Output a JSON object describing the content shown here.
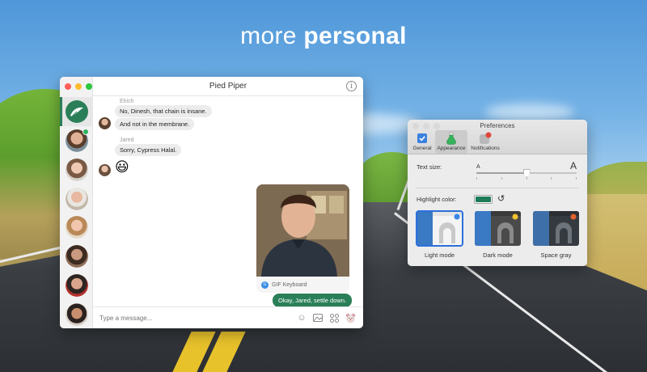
{
  "hero": {
    "light": "more ",
    "bold": "personal"
  },
  "chat": {
    "title": "Pied Piper",
    "messages": [
      {
        "sender": "Elrich",
        "lines": [
          "No, Dinesh, that chain is insane.",
          "And not in the membrane."
        ]
      },
      {
        "sender": "Jared",
        "lines": [
          "Sorry, Cypress Halal."
        ],
        "emoji": "😃"
      }
    ],
    "gif_source": "GIF Keyboard",
    "outgoing": "Okay, Jared, settle down.",
    "composer_placeholder": "Type a message..."
  },
  "prefs": {
    "title": "Preferences",
    "tabs": [
      "General",
      "Appearance",
      "Notifications"
    ],
    "selected_tab": "Appearance",
    "text_size_label": "Text size:",
    "text_size_min": "A",
    "text_size_max": "A",
    "text_size_value": 0.5,
    "highlight_label": "Highlight color:",
    "highlight_color": "#1c7a57",
    "themes": [
      "Light mode",
      "Dark mode",
      "Space gray"
    ],
    "selected_theme": "Light mode"
  },
  "colors": {
    "accent": "#2a7f58",
    "selection": "#2c6fdb",
    "online": "#2bb35e"
  }
}
